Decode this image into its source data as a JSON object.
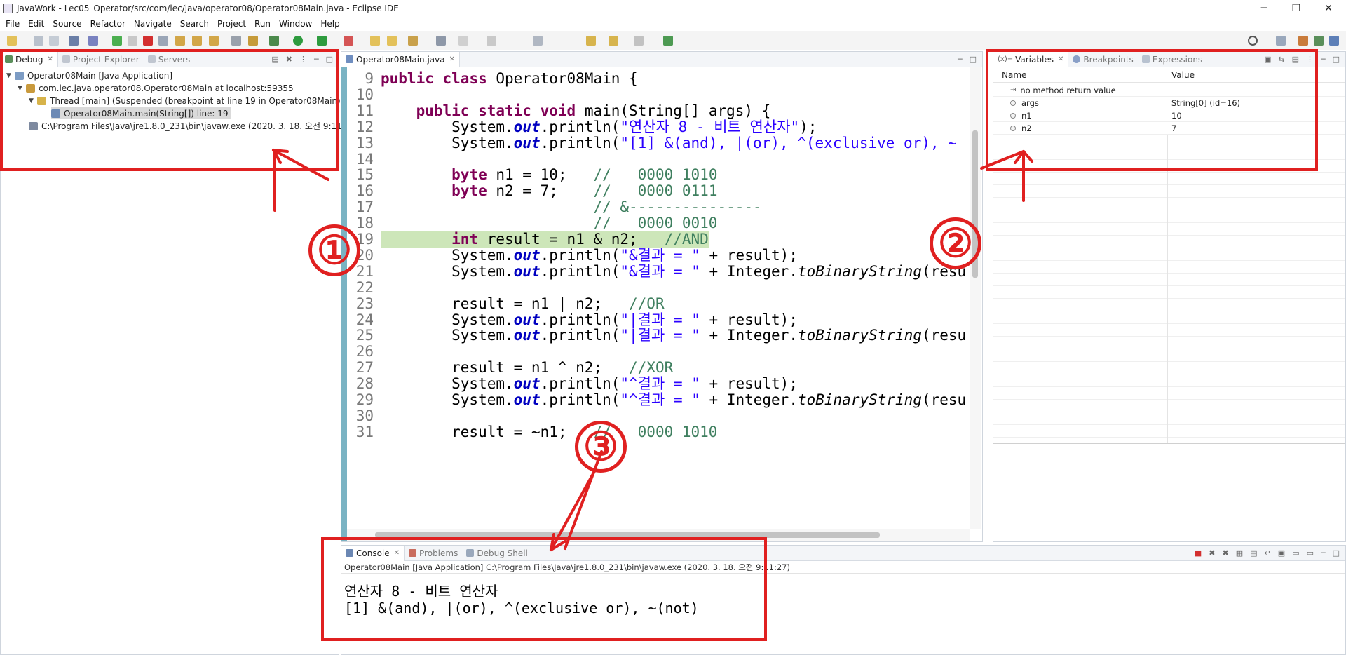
{
  "window": {
    "title": "JavaWork - Lec05_Operator/src/com/lec/java/operator08/Operator08Main.java - Eclipse IDE",
    "controls": [
      "─",
      "❐",
      "✕"
    ]
  },
  "menu": [
    "File",
    "Edit",
    "Source",
    "Refactor",
    "Navigate",
    "Search",
    "Project",
    "Run",
    "Window",
    "Help"
  ],
  "debug_panel": {
    "tabs": [
      "Debug",
      "Project Explorer",
      "Servers"
    ],
    "tree": [
      "Operator08Main [Java Application]",
      "com.lec.java.operator08.Operator08Main at localhost:59355",
      "Thread [main] (Suspended (breakpoint at line 19 in Operator08Main))",
      "Operator08Main.main(String[]) line: 19",
      "C:\\Program Files\\Java\\jre1.8.0_231\\bin\\javaw.exe (2020. 3. 18. 오전 9:11:"
    ]
  },
  "editor": {
    "tab": "Operator08Main.java",
    "lines": [
      {
        "n": "9",
        "code": "public class Operator08Main {"
      },
      {
        "n": "10",
        "code": ""
      },
      {
        "n": "11",
        "code": "    public static void main(String[] args) {"
      },
      {
        "n": "12",
        "code": "        System.out.println(\"연산자 8 - 비트 연산자\");"
      },
      {
        "n": "13",
        "code": "        System.out.println(\"[1] &(and), |(or), ^(exclusive or), ~"
      },
      {
        "n": "14",
        "code": ""
      },
      {
        "n": "15",
        "code": "        byte n1 = 10;   //   0000 1010"
      },
      {
        "n": "16",
        "code": "        byte n2 = 7;    //   0000 0111"
      },
      {
        "n": "17",
        "code": "                        // &---------------"
      },
      {
        "n": "18",
        "code": "                        //   0000 0010"
      },
      {
        "n": "19",
        "code": "        int result = n1 & n2;   //AND"
      },
      {
        "n": "20",
        "code": "        System.out.println(\"&결과 = \" + result);"
      },
      {
        "n": "21",
        "code": "        System.out.println(\"&결과 = \" + Integer.toBinaryString(resu"
      },
      {
        "n": "22",
        "code": ""
      },
      {
        "n": "23",
        "code": "        result = n1 | n2;   //OR"
      },
      {
        "n": "24",
        "code": "        System.out.println(\"|결과 = \" + result);"
      },
      {
        "n": "25",
        "code": "        System.out.println(\"|결과 = \" + Integer.toBinaryString(resu"
      },
      {
        "n": "26",
        "code": ""
      },
      {
        "n": "27",
        "code": "        result = n1 ^ n2;   //XOR"
      },
      {
        "n": "28",
        "code": "        System.out.println(\"^결과 = \" + result);"
      },
      {
        "n": "29",
        "code": "        System.out.println(\"^결과 = \" + Integer.toBinaryString(resu"
      },
      {
        "n": "30",
        "code": ""
      },
      {
        "n": "31",
        "code": "        result = ~n1;   //   0000 1010"
      }
    ]
  },
  "variables_panel": {
    "tabs": [
      "Variables",
      "Breakpoints",
      "Expressions"
    ],
    "columns": [
      "Name",
      "Value"
    ],
    "rows": [
      {
        "name": "no method return value",
        "value": ""
      },
      {
        "name": "args",
        "value": "String[0]  (id=16)"
      },
      {
        "name": "n1",
        "value": "10"
      },
      {
        "name": "n2",
        "value": "7"
      }
    ]
  },
  "console_panel": {
    "tabs": [
      "Console",
      "Problems",
      "Debug Shell"
    ],
    "path": "Operator08Main [Java Application] C:\\Program Files\\Java\\jre1.8.0_231\\bin\\javaw.exe (2020. 3. 18. 오전 9:11:27)",
    "output": [
      "연산자 8 - 비트 연산자",
      "[1] &(and), |(or), ^(exclusive or), ~(not)"
    ]
  },
  "annotations": [
    "①",
    "②",
    "③"
  ],
  "colors": {
    "annotation_red": "#e02020",
    "highlight_line": "#cde6b9",
    "keyword": "#7f0055",
    "string": "#2a00ff",
    "comment": "#3f7f5f"
  }
}
